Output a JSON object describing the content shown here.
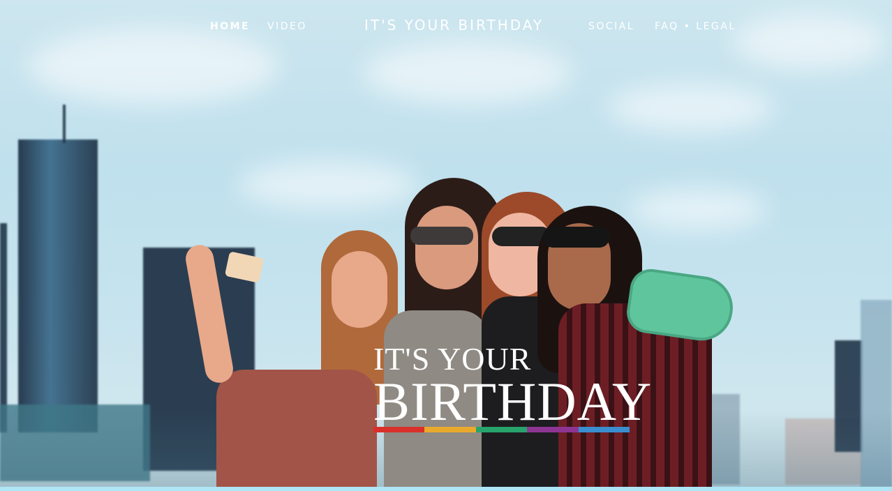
{
  "nav": {
    "home": "HOME",
    "video": "VIDEO",
    "brand": "IT'S YOUR BIRTHDAY",
    "social": "SOCIAL",
    "faq_legal": "FAQ • LEGAL"
  },
  "hero": {
    "logo_line1": "IT'S YOUR",
    "logo_line2": "BIRTHDAY",
    "stripe_colors": [
      "#d9302b",
      "#e9a92c",
      "#27a36b",
      "#8e3593",
      "#3a8ed0"
    ]
  },
  "colors": {
    "accent_bar": "#aee6f6"
  }
}
